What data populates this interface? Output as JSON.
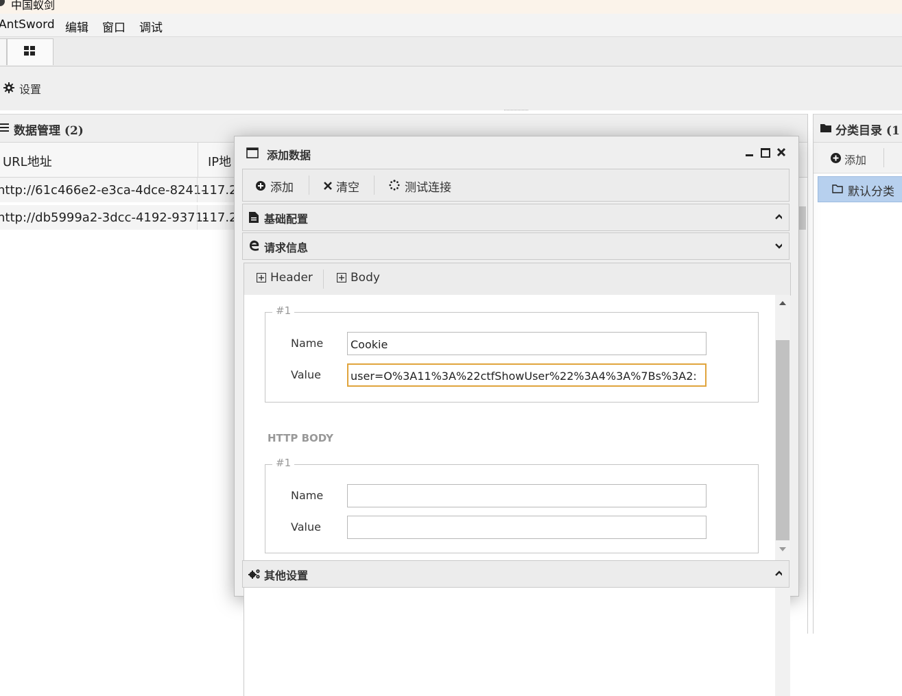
{
  "app": {
    "title": "中国蚁剑"
  },
  "menu": {
    "items": [
      "AntSword",
      "编辑",
      "窗口",
      "调试"
    ]
  },
  "toolbar": {
    "settings_label": "设置"
  },
  "data_panel": {
    "title": "数据管理 (2)",
    "columns": [
      "URL地址",
      "IP地"
    ],
    "rows": [
      {
        "url": "http://61c466e2-e3ca-4dce-8241-",
        "ip": "117.2"
      },
      {
        "url": "http://db5999a2-3dcc-4192-9371-",
        "ip": "117.2"
      }
    ]
  },
  "category_panel": {
    "title": "分类目录 (1",
    "add_label": "添加",
    "items": [
      "默认分类"
    ]
  },
  "dialog": {
    "title": "添加数据",
    "toolbar": {
      "add": "添加",
      "clear": "清空",
      "test": "测试连接"
    },
    "sections": {
      "basic": "基础配置",
      "request": "请求信息",
      "other": "其他设置"
    },
    "subtabs": [
      "Header",
      "Body"
    ],
    "header_group": {
      "legend": "#1",
      "name_label": "Name",
      "value_label": "Value",
      "name_value": "Cookie",
      "value_value": "user=O%3A11%3A%22ctfShowUser%22%3A4%3A%7Bs%3A2:"
    },
    "body_section_title": "HTTP BODY",
    "body_group": {
      "legend": "#1",
      "name_label": "Name",
      "value_label": "Value",
      "name_value": "",
      "value_value": ""
    }
  }
}
